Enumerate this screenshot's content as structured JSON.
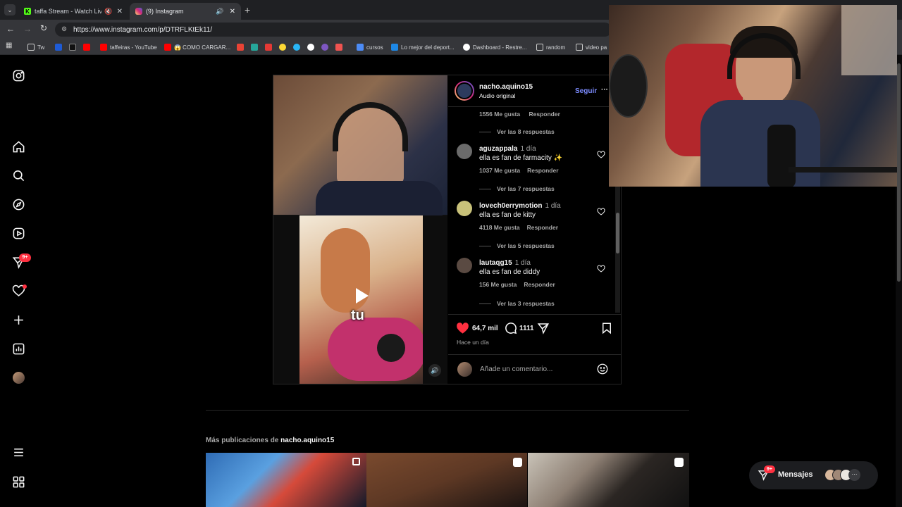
{
  "browser": {
    "tabs": [
      {
        "title": "taffa Stream - Watch Live on Kick"
      },
      {
        "title": "(9) Instagram"
      }
    ],
    "new_tab_label": "+",
    "url": "https://www.instagram.com/p/DTRFLKtEk11/",
    "bookmarks": [
      {
        "label": "Tw",
        "color": "#3b82f6"
      },
      {
        "label": "taffeiras - YouTube",
        "color": "#ff0000"
      },
      {
        "label": "😱 COMO CARGAR...",
        "color": "#ff0000"
      },
      {
        "label": "cursos",
        "color": "#4c8bf5"
      },
      {
        "label": "Lo mejor del deport...",
        "color": "#1e88e5"
      },
      {
        "label": "Dashboard - Restre...",
        "color": "#ffffff"
      },
      {
        "label": "random",
        "color": "#9aa0a6"
      },
      {
        "label": "video pa",
        "color": "#9aa0a6"
      }
    ]
  },
  "sidebar": {
    "notification_badge": "9+"
  },
  "post": {
    "username": "nacho.aquino15",
    "audio": "Audio original",
    "follow_label": "Seguir",
    "more_label": "···",
    "caption_overlay": "tu",
    "top_meta": {
      "likes": "1556 Me gusta",
      "reply": "Responder"
    },
    "top_replies": "Ver las 8 respuestas",
    "comments": [
      {
        "user": "aguzappala",
        "time": "1 día",
        "text": "ella es fan de farmacity ✨",
        "likes": "1037 Me gusta",
        "reply": "Responder",
        "replies": "Ver las 7 respuestas",
        "avatar_color": "#6b6b6b"
      },
      {
        "user": "lovech0errymotion",
        "time": "1 día",
        "text": "ella es fan de kitty",
        "likes": "4118 Me gusta",
        "reply": "Responder",
        "replies": "Ver las 5 respuestas",
        "avatar_color": "#c9c27a"
      },
      {
        "user": "lautaqg15",
        "time": "1 día",
        "text": "ella es fan de diddy",
        "likes": "156 Me gusta",
        "reply": "Responder",
        "replies": "Ver las 3 respuestas",
        "avatar_color": "#5a4a42"
      }
    ],
    "like_count": "64,7 mil",
    "comment_count": "1111",
    "posted": "Hace un día",
    "comment_placeholder": "Añade un comentario..."
  },
  "more_posts": {
    "prefix": "Más publicaciones de",
    "username": "nacho.aquino15"
  },
  "messages": {
    "label": "Mensajes",
    "badge": "9+"
  },
  "colors": {
    "accent": "#4f5bd5",
    "like_red": "#ff3040",
    "badge_red": "#ff3040"
  }
}
